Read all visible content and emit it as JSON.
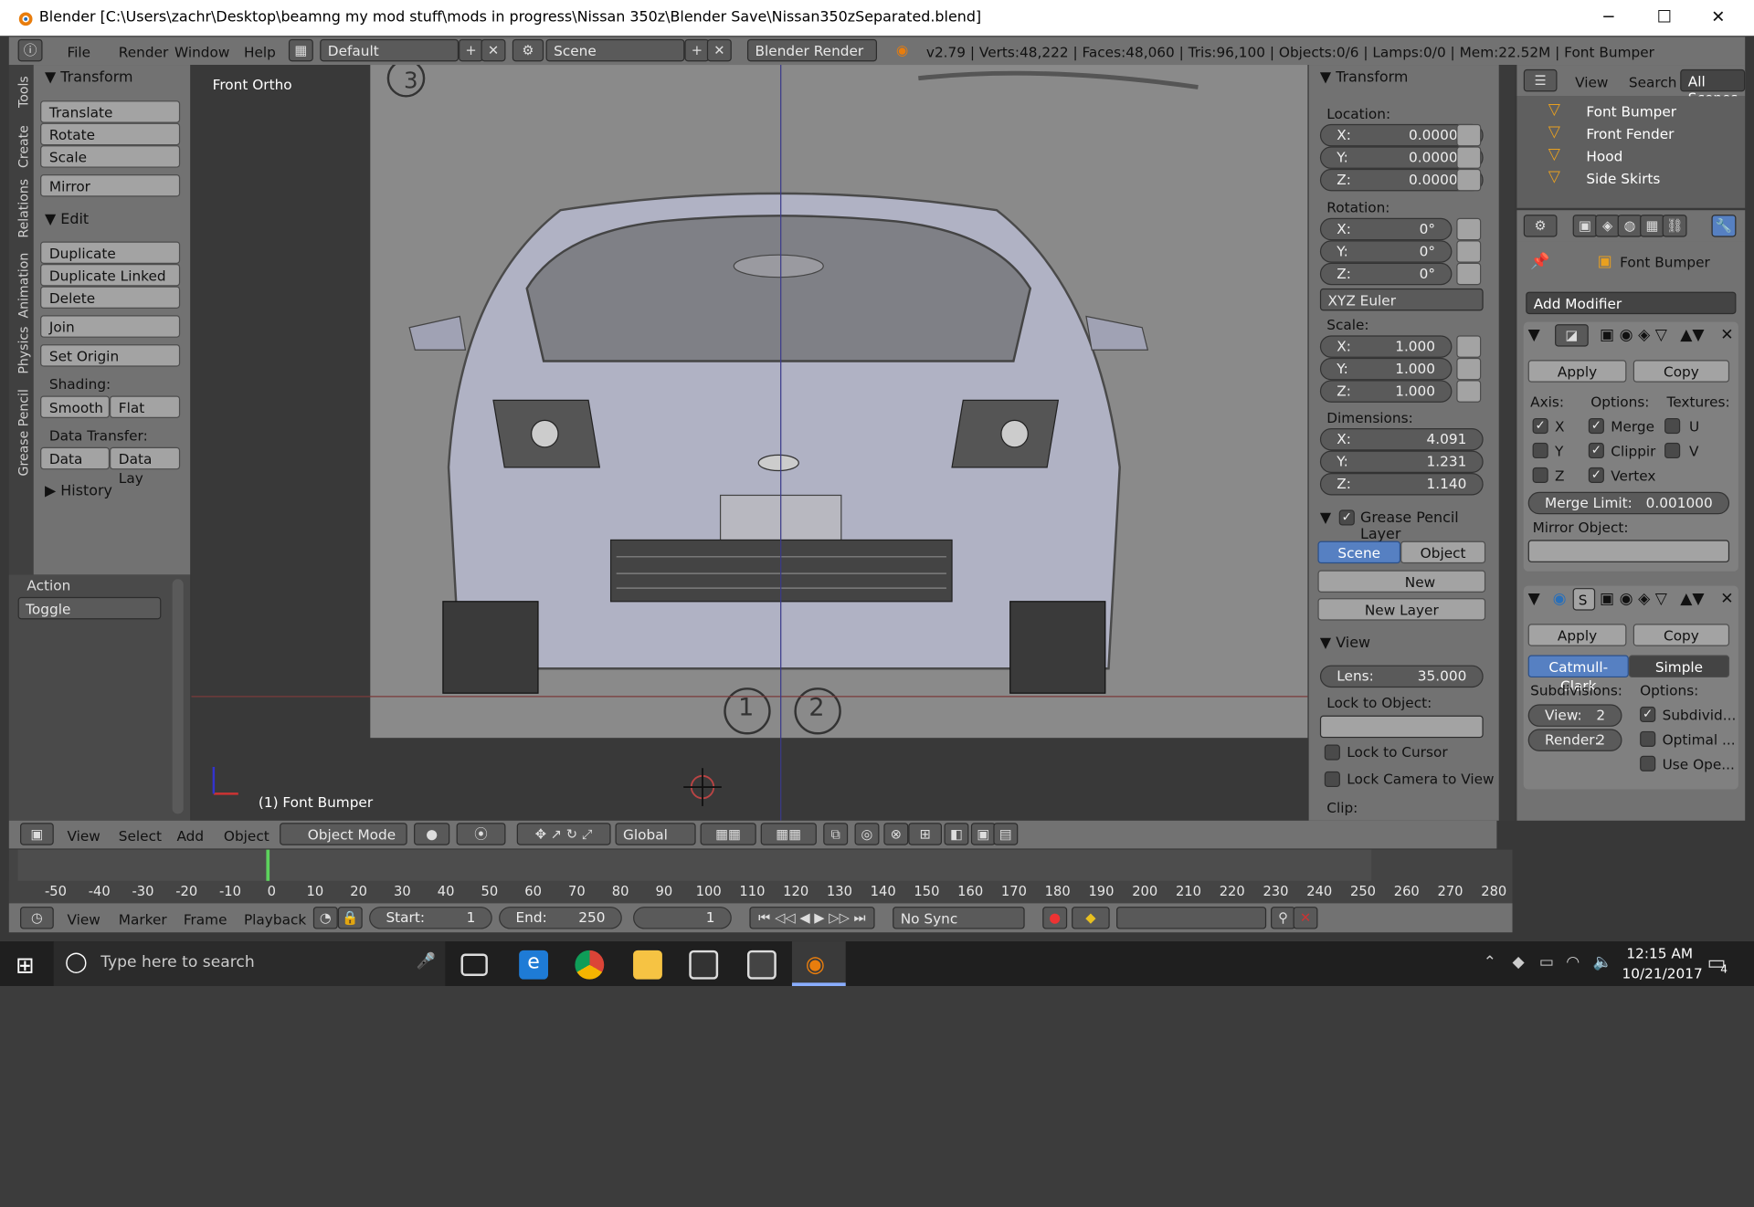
{
  "window": {
    "title": "Blender [C:\\Users\\zachr\\Desktop\\beamng my mod stuff\\mods in progress\\Nissan 350z\\Blender Save\\Nissan350zSeparated.blend]",
    "min": "─",
    "max": "☐",
    "close": "✕"
  },
  "info_header": {
    "menus": [
      "File",
      "Render",
      "Window",
      "Help"
    ],
    "screen": "Default",
    "scene": "Scene",
    "engine": "Blender Render",
    "stats": "v2.79 | Verts:48,222 | Faces:48,060 | Tris:96,100 | Objects:0/6 | Lamps:0/0 | Mem:22.52M | Font Bumper"
  },
  "tool_tabs": [
    "Tools",
    "Create",
    "Relations",
    "Animation",
    "Physics",
    "Grease Pencil"
  ],
  "tool_shelf": {
    "transform_title": "Transform",
    "transform_buttons": [
      "Translate",
      "Rotate",
      "Scale"
    ],
    "mirror": "Mirror",
    "edit_title": "Edit",
    "edit_buttons": [
      "Duplicate",
      "Duplicate Linked",
      "Delete"
    ],
    "join": "Join",
    "set_origin": "Set Origin",
    "shading_label": "Shading:",
    "smooth": "Smooth",
    "flat": "Flat",
    "data_transfer_label": "Data Transfer:",
    "data": "Data",
    "data_lay": "Data Lay",
    "history_title": "History",
    "action_label": "Action",
    "action_value": "Toggle"
  },
  "viewport": {
    "view_name": "Front Ortho",
    "object_label": "(1) Font Bumper",
    "mark_3": "3",
    "mark_1": "1",
    "mark_2": "2"
  },
  "properties_panel": {
    "transform_title": "Transform",
    "location_label": "Location:",
    "location": [
      {
        "k": "X:",
        "v": "0.00000"
      },
      {
        "k": "Y:",
        "v": "0.00000"
      },
      {
        "k": "Z:",
        "v": "0.00000"
      }
    ],
    "rotation_label": "Rotation:",
    "rotation": [
      {
        "k": "X:",
        "v": "0°"
      },
      {
        "k": "Y:",
        "v": "0°"
      },
      {
        "k": "Z:",
        "v": "0°"
      }
    ],
    "rotation_mode": "XYZ Euler",
    "scale_label": "Scale:",
    "scale": [
      {
        "k": "X:",
        "v": "1.000"
      },
      {
        "k": "Y:",
        "v": "1.000"
      },
      {
        "k": "Z:",
        "v": "1.000"
      }
    ],
    "dimensions_label": "Dimensions:",
    "dimensions": [
      {
        "k": "X:",
        "v": "4.091"
      },
      {
        "k": "Y:",
        "v": "1.231"
      },
      {
        "k": "Z:",
        "v": "1.140"
      }
    ],
    "grease_title": "Grease Pencil Layer",
    "scene_btn": "Scene",
    "object_btn": "Object",
    "new_btn": "New",
    "new_layer_btn": "New Layer",
    "view_title": "View",
    "lens_label": "Lens:",
    "lens_value": "35.000",
    "lock_to_object_label": "Lock to Object:",
    "lock_to_cursor": "Lock to Cursor",
    "lock_camera": "Lock Camera to View",
    "clip_label": "Clip:"
  },
  "outliner": {
    "view": "View",
    "search": "Search",
    "all_scenes": "All Scenes",
    "items": [
      "Font Bumper",
      "Front Fender",
      "Hood",
      "Side Skirts"
    ]
  },
  "modifier_panel": {
    "object_name": "Font Bumper",
    "add_modifier": "Add Modifier",
    "apply": "Apply",
    "copy": "Copy",
    "axis_label": "Axis:",
    "options_label": "Options:",
    "textures_label": "Textures:",
    "axis": [
      "X",
      "Y",
      "Z"
    ],
    "options": [
      "Merge",
      "Clipping",
      "Vertex Groups"
    ],
    "textures": [
      "U",
      "V"
    ],
    "merge_limit_label": "Merge Limit:",
    "merge_limit_value": "0.001000",
    "mirror_object_label": "Mirror Object:",
    "subsurf_name": "S",
    "apply2": "Apply",
    "copy2": "Copy",
    "catmull": "Catmull-Clark",
    "simple": "Simple",
    "subdivisions_label": "Subdivisions:",
    "options2_label": "Options:",
    "view_level": "View:",
    "view_level_value": "2",
    "render_level": "Render:",
    "render_level_value": "2",
    "subdiv_uv": "Subdivid...",
    "optimal": "Optimal ...",
    "use_ope": "Use Ope..."
  },
  "view3d_header": {
    "menus": [
      "View",
      "Select",
      "Add",
      "Object"
    ],
    "mode": "Object Mode",
    "orientation": "Global"
  },
  "timeline": {
    "ruler": [
      "-50",
      "-40",
      "-30",
      "-20",
      "-10",
      "0",
      "10",
      "20",
      "30",
      "40",
      "50",
      "60",
      "70",
      "80",
      "90",
      "100",
      "110",
      "120",
      "130",
      "140",
      "150",
      "160",
      "170",
      "180",
      "190",
      "200",
      "210",
      "220",
      "230",
      "240",
      "250",
      "260",
      "270",
      "280"
    ],
    "menus": [
      "View",
      "Marker",
      "Frame",
      "Playback"
    ],
    "start_label": "Start:",
    "start_value": "1",
    "end_label": "End:",
    "end_value": "250",
    "current": "1",
    "sync": "No Sync"
  },
  "taskbar": {
    "search_placeholder": "Type here to search",
    "time": "12:15 AM",
    "date": "10/21/2017",
    "notif_count": "4"
  }
}
